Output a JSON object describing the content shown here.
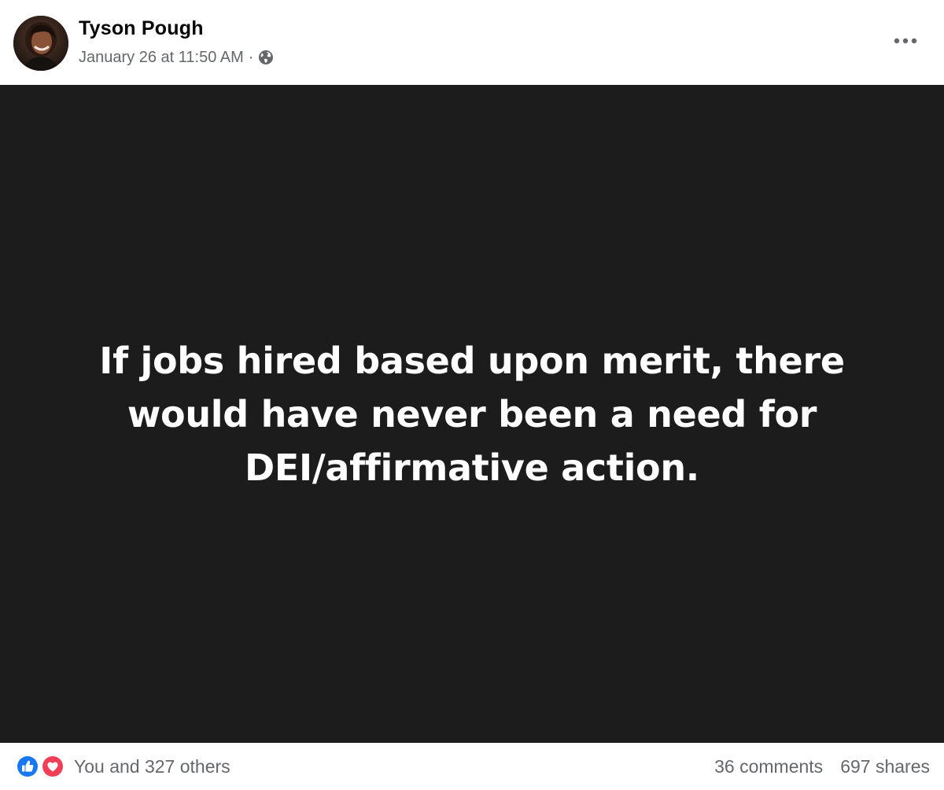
{
  "post": {
    "author": "Tyson Pough",
    "timestamp": "January 26 at 11:50 AM",
    "separator": "·",
    "privacy_icon": "globe-icon",
    "more_icon": "more-options-icon",
    "quote": "If jobs hired based upon merit, there would have never been a need for DEI/affirmative action.",
    "quote_background": "#1c1c1c",
    "quote_text_color": "#ffffff"
  },
  "footer": {
    "reaction_icons": [
      "like-icon",
      "love-icon"
    ],
    "reactions_text": "You and 327 others",
    "comments": "36 comments",
    "shares": "697 shares"
  },
  "colors": {
    "like_blue": "#1877f2",
    "love_red": "#f33e58",
    "secondary_text": "#65676b",
    "primary_text": "#050505"
  }
}
